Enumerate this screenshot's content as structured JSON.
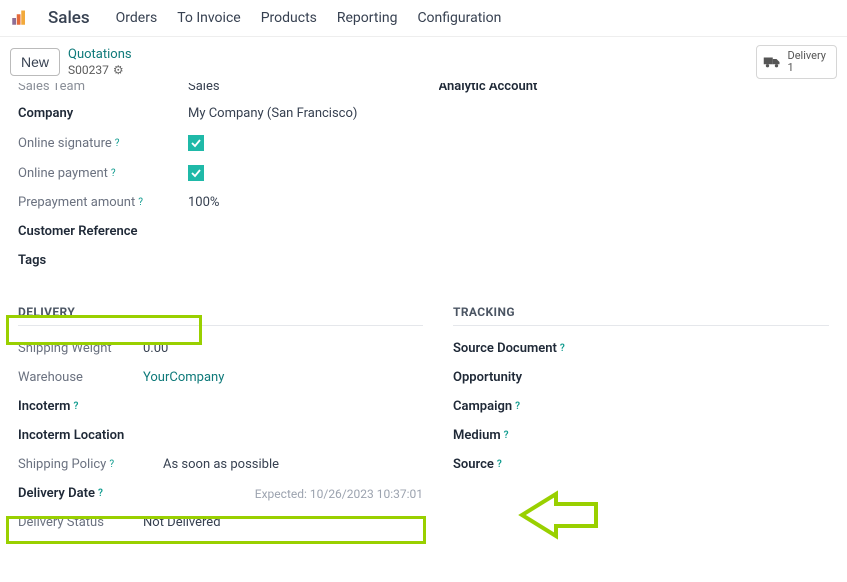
{
  "app": {
    "title": "Sales"
  },
  "nav": {
    "orders": "Orders",
    "toInvoice": "To Invoice",
    "products": "Products",
    "reporting": "Reporting",
    "configuration": "Configuration"
  },
  "subheader": {
    "newLabel": "New",
    "crumbTop": "Quotations",
    "crumbId": "S00237",
    "deliveryLabel": "Delivery",
    "deliveryCount": "1"
  },
  "cutoff": {
    "leftLabel": "Sales Team",
    "leftValue": "Sales",
    "rightLabel": "Analytic Account"
  },
  "fields": {
    "company": {
      "label": "Company",
      "value": "My Company (San Francisco)"
    },
    "onlineSignature": {
      "label": "Online signature"
    },
    "onlinePayment": {
      "label": "Online payment"
    },
    "prepayment": {
      "label": "Prepayment amount",
      "value": "100%"
    },
    "customerRef": {
      "label": "Customer Reference"
    },
    "tags": {
      "label": "Tags"
    }
  },
  "delivery": {
    "title": "DELIVERY",
    "shippingWeight": {
      "label": "Shipping Weight",
      "value": "0.00"
    },
    "warehouse": {
      "label": "Warehouse",
      "value": "YourCompany"
    },
    "incoterm": {
      "label": "Incoterm"
    },
    "incotermLocation": {
      "label": "Incoterm Location"
    },
    "shippingPolicy": {
      "label": "Shipping Policy",
      "value": "As soon as possible"
    },
    "deliveryDate": {
      "label": "Delivery Date",
      "expected": "Expected: 10/26/2023 10:37:01"
    },
    "deliveryStatus": {
      "label": "Delivery Status",
      "value": "Not Delivered"
    }
  },
  "tracking": {
    "title": "TRACKING",
    "sourceDoc": {
      "label": "Source Document"
    },
    "opportunity": {
      "label": "Opportunity"
    },
    "campaign": {
      "label": "Campaign"
    },
    "medium": {
      "label": "Medium"
    },
    "source": {
      "label": "Source"
    }
  }
}
